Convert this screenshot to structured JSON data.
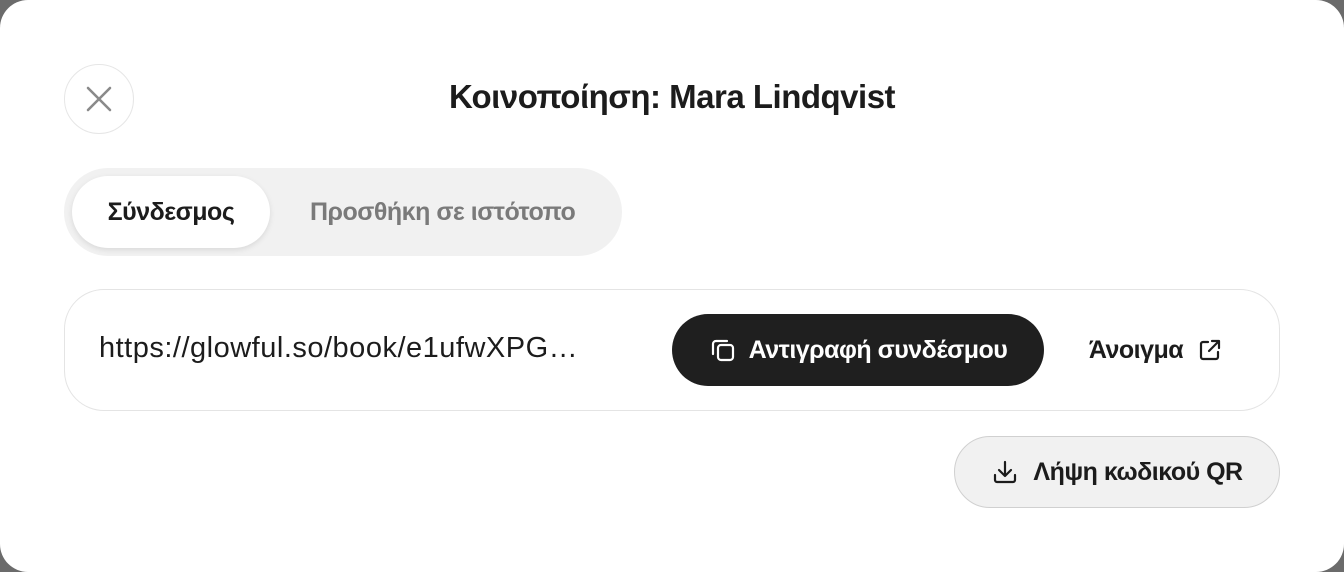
{
  "modal": {
    "title": "Κοινοποίηση: Mara Lindqvist"
  },
  "tabs": [
    {
      "label": "Σύνδεσμος",
      "active": true
    },
    {
      "label": "Προσθήκη σε ιστότοπο",
      "active": false
    }
  ],
  "link": {
    "url": "https://glowful.so/book/e1ufwXPG…",
    "copy_label": "Αντιγραφή συνδέσμου",
    "open_label": "Άνοιγμα"
  },
  "qr": {
    "download_label": "Λήψη κωδικού QR"
  },
  "icons": {
    "close": "close-icon",
    "copy": "copy-icon",
    "external": "external-link-icon",
    "download": "download-icon"
  },
  "colors": {
    "primary_button": "#1f1f1f",
    "tab_track": "#f1f1f1",
    "text": "#1c1c1c",
    "muted_text": "#7a7a7a"
  }
}
